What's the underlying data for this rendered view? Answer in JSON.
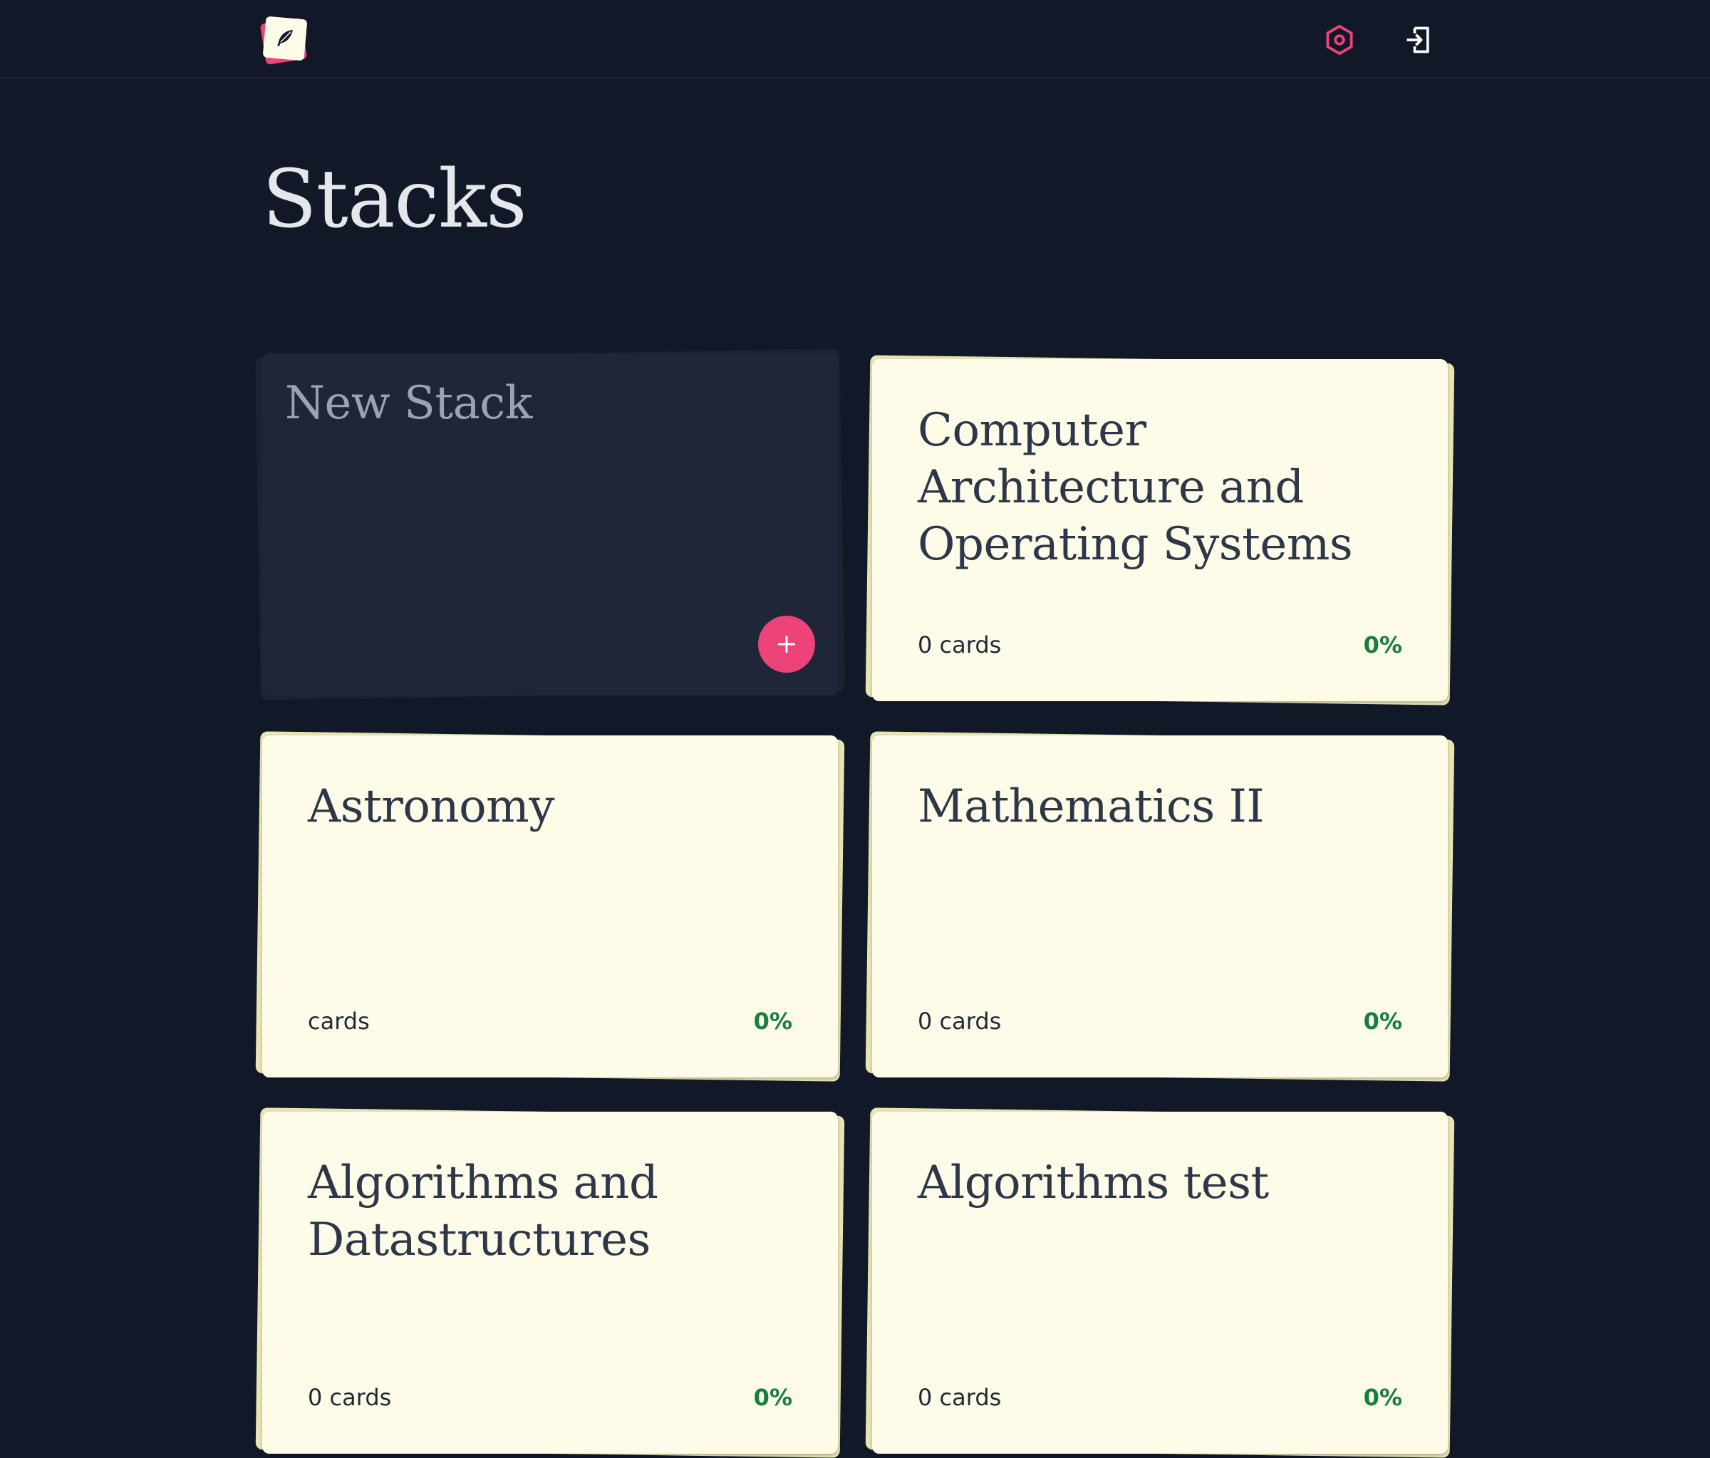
{
  "header": {
    "logo_icon": "feather-logo-icon",
    "settings_icon": "settings-hexagon-icon",
    "login_icon": "sign-in-icon",
    "accent_color": "#ec4379"
  },
  "page": {
    "title": "Stacks"
  },
  "new_stack": {
    "label": "New Stack",
    "add_icon": "plus-icon"
  },
  "stacks": [
    {
      "title": "Computer Architecture and Operating Systems",
      "count": "0 cards",
      "progress": "0%"
    },
    {
      "title": "Astronomy",
      "count": "cards",
      "progress": "0%"
    },
    {
      "title": "Mathematics II",
      "count": "0 cards",
      "progress": "0%"
    },
    {
      "title": "Algorithms and Datastructures",
      "count": "0 cards",
      "progress": "0%"
    },
    {
      "title": "Algorithms test",
      "count": "0 cards",
      "progress": "0%"
    }
  ]
}
